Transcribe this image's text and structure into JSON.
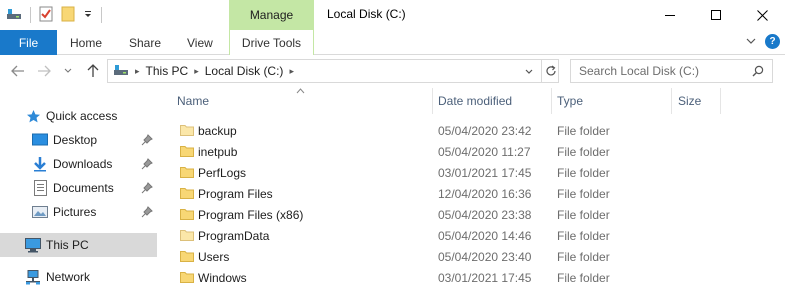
{
  "window": {
    "title": "Local Disk (C:)",
    "contextual_tab_group": "Manage"
  },
  "ribbon": {
    "tabs": [
      {
        "label": "File"
      },
      {
        "label": "Home"
      },
      {
        "label": "Share"
      },
      {
        "label": "View"
      },
      {
        "label": "Drive Tools"
      }
    ],
    "help_label": "?"
  },
  "address": {
    "crumbs": [
      "This PC",
      "Local Disk (C:)"
    ],
    "search_placeholder": "Search Local Disk (C:)"
  },
  "navpane": {
    "quick_access": "Quick access",
    "pinned": [
      {
        "label": "Desktop",
        "icon": "desktop-icon"
      },
      {
        "label": "Downloads",
        "icon": "downloads-icon"
      },
      {
        "label": "Documents",
        "icon": "documents-icon"
      },
      {
        "label": "Pictures",
        "icon": "pictures-icon"
      }
    ],
    "this_pc": "This PC",
    "network": "Network"
  },
  "columns": {
    "name": "Name",
    "date": "Date modified",
    "type": "Type",
    "size": "Size"
  },
  "files": [
    {
      "name": "backup",
      "date": "05/04/2020 23:42",
      "type": "File folder"
    },
    {
      "name": "inetpub",
      "date": "05/04/2020 11:27",
      "type": "File folder"
    },
    {
      "name": "PerfLogs",
      "date": "03/01/2021 17:45",
      "type": "File folder"
    },
    {
      "name": "Program Files",
      "date": "12/04/2020 16:36",
      "type": "File folder"
    },
    {
      "name": "Program Files (x86)",
      "date": "05/04/2020 23:38",
      "type": "File folder"
    },
    {
      "name": "ProgramData",
      "date": "05/04/2020 14:46",
      "type": "File folder"
    },
    {
      "name": "Users",
      "date": "05/04/2020 23:40",
      "type": "File folder"
    },
    {
      "name": "Windows",
      "date": "03/01/2021 17:45",
      "type": "File folder"
    }
  ],
  "colors": {
    "file_tab": "#1979ca",
    "manage_tab": "#c4e7a5",
    "folder": "#f8d775",
    "selected": "#d9d9d9"
  }
}
